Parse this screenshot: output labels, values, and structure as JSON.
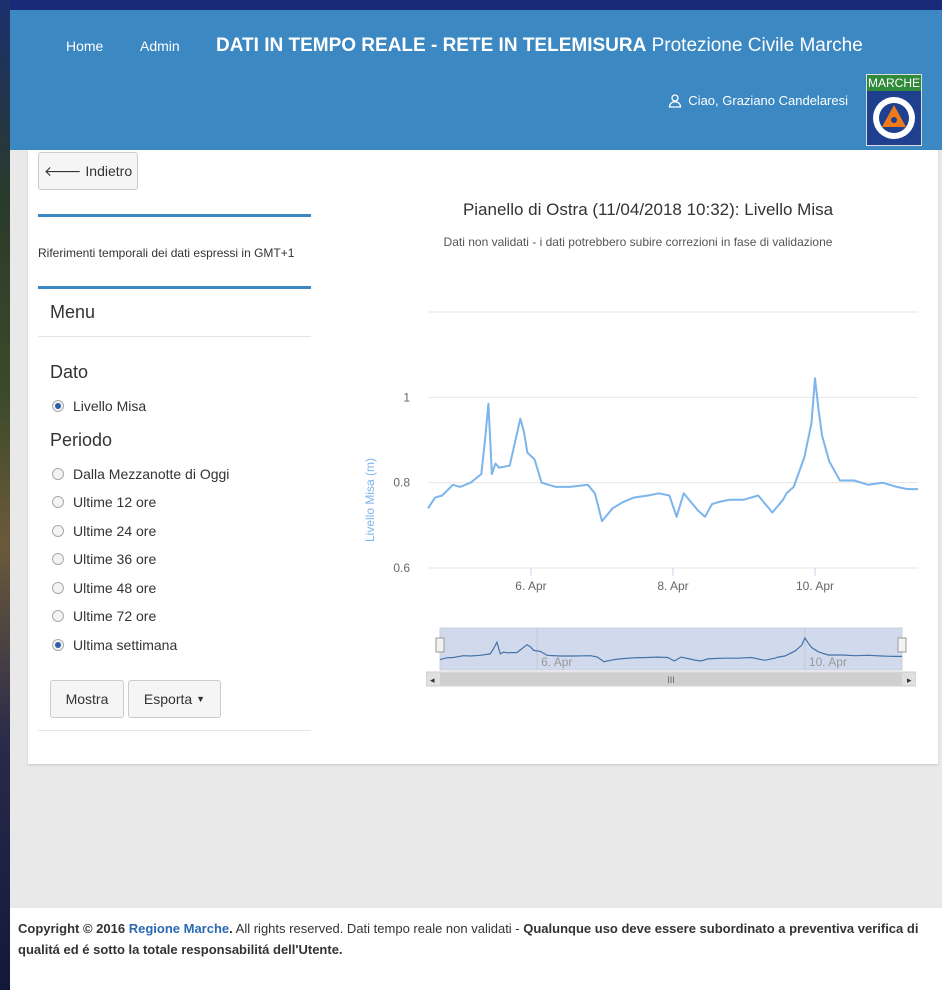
{
  "header": {
    "nav": [
      "Home",
      "Admin"
    ],
    "brand_bold": "DATI IN TEMPO REALE - RETE IN TELEMISURA",
    "brand_rest": "Protezione Civile Marche",
    "user_label": "Ciao, Graziano Candelaresi",
    "logo_text": "MARCHE",
    "user_icon": "user-icon"
  },
  "sidebar": {
    "back_label": "Indietro",
    "time_note": "Riferimenti temporali dei dati espressi in GMT+1",
    "menu_title": "Menu",
    "dato_title": "Dato",
    "dato_options": [
      {
        "label": "Livello Misa",
        "checked": true
      }
    ],
    "periodo_title": "Periodo",
    "periodo_options": [
      {
        "label": "Dalla Mezzanotte di Oggi",
        "checked": false
      },
      {
        "label": "Ultime 12 ore",
        "checked": false
      },
      {
        "label": "Ultime 24 ore",
        "checked": false
      },
      {
        "label": "Ultime 36 ore",
        "checked": false
      },
      {
        "label": "Ultime 48 ore",
        "checked": false
      },
      {
        "label": "Ultime 72 ore",
        "checked": false
      },
      {
        "label": "Ultima settimana",
        "checked": true
      }
    ],
    "show_label": "Mostra",
    "export_label": "Esporta"
  },
  "chart": {
    "title": "Pianello di Ostra (11/04/2018 10:32): Livello Misa",
    "subtitle": "Dati non validati - i dati potrebbero subire correzioni in fase di validazione"
  },
  "chart_data": {
    "type": "line",
    "title": "Pianello di Ostra (11/04/2018 10:32): Livello Misa",
    "subtitle": "Dati non validati - i dati potrebbero subire correzioni in fase di validazione",
    "ylabel": "Livello Misa (m)",
    "xlabel": "",
    "y_ticks": [
      "0.6",
      "0.8",
      "1"
    ],
    "x_ticks": [
      "6. Apr",
      "8. Apr",
      "10. Apr"
    ],
    "x_tick_days": [
      6,
      8,
      10
    ],
    "xlim": [
      4.55,
      11.45
    ],
    "ylim": [
      0.6,
      1.2
    ],
    "grid": true,
    "color": "#7cb5ec",
    "navigator_ticks": [
      "6. Apr",
      "10. Apr"
    ],
    "series": [
      {
        "x": [
          4.55,
          4.65,
          4.75,
          4.9,
          5.0,
          5.15,
          5.3,
          5.35,
          5.4,
          5.45,
          5.5,
          5.55,
          5.7,
          5.85,
          5.9,
          5.95,
          6.05,
          6.15,
          6.35,
          6.55,
          6.8,
          6.9,
          7.0,
          7.15,
          7.3,
          7.45,
          7.65,
          7.8,
          7.95,
          8.05,
          8.15,
          8.25,
          8.35,
          8.45,
          8.55,
          8.65,
          8.8,
          9.0,
          9.2,
          9.4,
          9.55,
          9.6,
          9.7,
          9.85,
          9.95,
          10.0,
          10.05,
          10.1,
          10.2,
          10.35,
          10.55,
          10.75,
          10.95,
          11.15,
          11.3,
          11.45
        ],
        "y": [
          0.74,
          0.765,
          0.77,
          0.795,
          0.79,
          0.8,
          0.82,
          0.895,
          0.985,
          0.82,
          0.845,
          0.835,
          0.84,
          0.95,
          0.92,
          0.87,
          0.855,
          0.8,
          0.79,
          0.79,
          0.795,
          0.775,
          0.71,
          0.74,
          0.755,
          0.765,
          0.77,
          0.775,
          0.77,
          0.72,
          0.775,
          0.755,
          0.735,
          0.72,
          0.75,
          0.755,
          0.76,
          0.76,
          0.77,
          0.73,
          0.76,
          0.775,
          0.79,
          0.86,
          0.94,
          1.045,
          0.97,
          0.91,
          0.85,
          0.805,
          0.805,
          0.795,
          0.8,
          0.79,
          0.785,
          0.785
        ]
      }
    ]
  }
}
